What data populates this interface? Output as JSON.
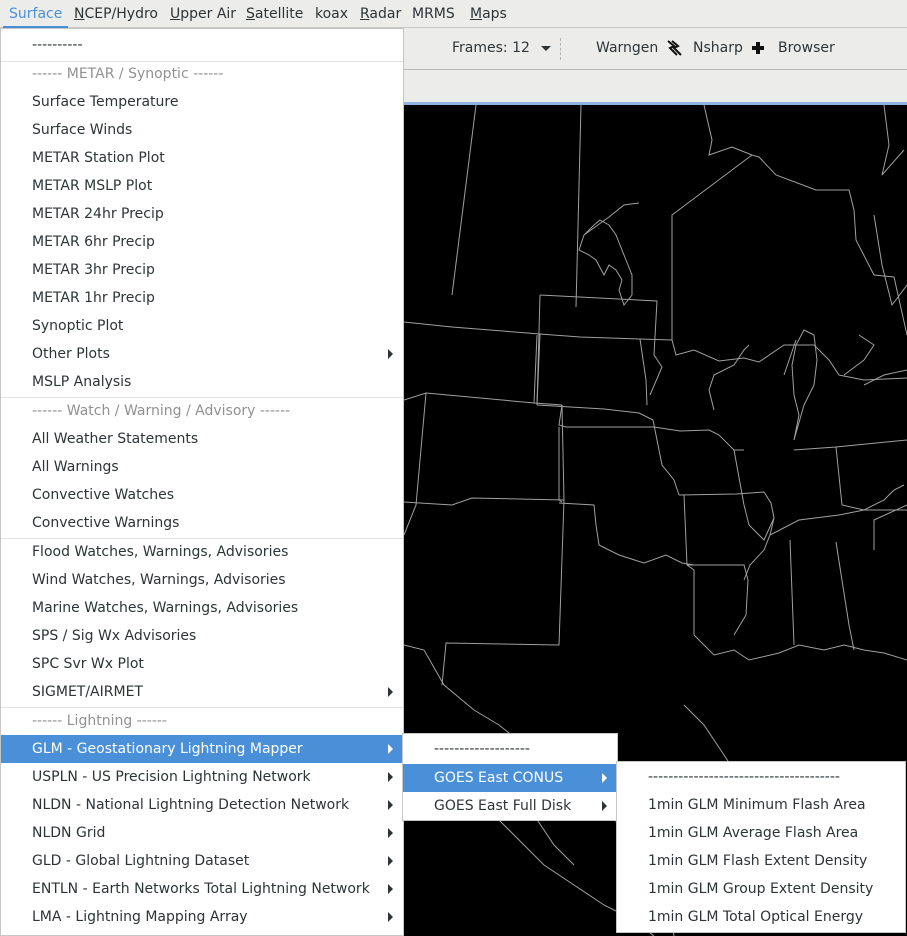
{
  "menubar": {
    "items": [
      {
        "label": "Surface",
        "mnemonic": "",
        "active": true
      },
      {
        "label": "NCEP/Hydro",
        "mnemonic": "N"
      },
      {
        "label": "Upper Air",
        "mnemonic": "U"
      },
      {
        "label": "Satellite",
        "mnemonic": "S"
      },
      {
        "label": "koax",
        "mnemonic": ""
      },
      {
        "label": "Radar",
        "mnemonic": "R"
      },
      {
        "label": "MRMS",
        "mnemonic": ""
      },
      {
        "label": "Maps",
        "mnemonic": "M"
      }
    ]
  },
  "toolbar": {
    "frames_label": "Frames: 12",
    "frames_icon": "dropdown-arrow-icon",
    "warngen_label": "Warngen",
    "warngen_icon": "lightning-arrows-icon",
    "nsharp_label": "Nsharp",
    "nsharp_icon": "plus-icon",
    "browser_label": "Browser"
  },
  "surface_menu": {
    "items": [
      {
        "label": "----------",
        "type": "item"
      },
      {
        "label": "------ METAR / Synoptic ------",
        "type": "header"
      },
      {
        "label": "Surface Temperature",
        "type": "item"
      },
      {
        "label": "Surface Winds",
        "type": "item"
      },
      {
        "label": "METAR Station Plot",
        "type": "item"
      },
      {
        "label": "METAR MSLP Plot",
        "type": "item"
      },
      {
        "label": "METAR 24hr Precip",
        "type": "item"
      },
      {
        "label": "METAR 6hr Precip",
        "type": "item"
      },
      {
        "label": "METAR 3hr Precip",
        "type": "item"
      },
      {
        "label": "METAR 1hr Precip",
        "type": "item"
      },
      {
        "label": "Synoptic Plot",
        "type": "item"
      },
      {
        "label": "Other Plots",
        "type": "submenu"
      },
      {
        "label": "MSLP Analysis",
        "type": "item"
      },
      {
        "label": "------ Watch / Warning / Advisory ------",
        "type": "header"
      },
      {
        "label": "All Weather Statements",
        "type": "item"
      },
      {
        "label": "All Warnings",
        "type": "item"
      },
      {
        "label": "Convective Watches",
        "type": "item"
      },
      {
        "label": "Convective Warnings",
        "type": "item"
      },
      {
        "label": "Flood Watches, Warnings, Advisories",
        "type": "item"
      },
      {
        "label": "Wind Watches, Warnings, Advisories",
        "type": "item"
      },
      {
        "label": "Marine Watches, Warnings, Advisories",
        "type": "item"
      },
      {
        "label": "SPS / Sig Wx Advisories",
        "type": "item"
      },
      {
        "label": "SPC Svr Wx Plot",
        "type": "item"
      },
      {
        "label": "SIGMET/AIRMET",
        "type": "submenu"
      },
      {
        "label": "------ Lightning ------",
        "type": "header"
      },
      {
        "label": "GLM - Geostationary Lightning Mapper",
        "type": "submenu",
        "highlighted": true
      },
      {
        "label": "USPLN - US Precision Lightning Network",
        "type": "submenu"
      },
      {
        "label": "NLDN - National Lightning Detection Network",
        "type": "submenu"
      },
      {
        "label": "NLDN Grid",
        "type": "submenu"
      },
      {
        "label": "GLD - Global Lightning Dataset",
        "type": "submenu"
      },
      {
        "label": "ENTLN - Earth Networks Total Lightning Network",
        "type": "submenu"
      },
      {
        "label": "LMA - Lightning Mapping Array",
        "type": "submenu"
      }
    ]
  },
  "glm_menu": {
    "items": [
      {
        "label": "-------------------",
        "type": "item"
      },
      {
        "label": "GOES East CONUS",
        "type": "submenu",
        "highlighted": true
      },
      {
        "label": "GOES East Full Disk",
        "type": "submenu"
      }
    ]
  },
  "conus_menu": {
    "items": [
      {
        "label": "--------------------------------------",
        "type": "item"
      },
      {
        "label": "1min GLM Minimum Flash Area",
        "type": "item"
      },
      {
        "label": "1min GLM Average Flash Area",
        "type": "item"
      },
      {
        "label": "1min GLM Flash Extent Density",
        "type": "item"
      },
      {
        "label": "1min GLM Group Extent Density",
        "type": "item"
      },
      {
        "label": "1min GLM Total Optical Energy",
        "type": "item"
      }
    ]
  },
  "colors": {
    "accent": "#4a90d9",
    "menu_bg": "#ffffff",
    "header_text": "#919191",
    "map_bg": "#000000",
    "map_lines": "#a0a0a0"
  }
}
